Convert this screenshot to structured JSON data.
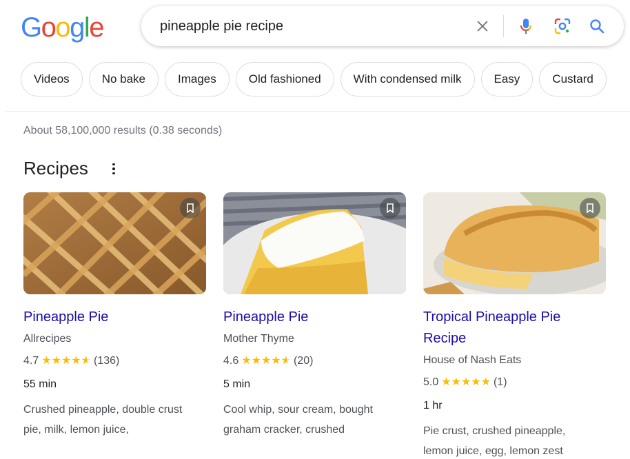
{
  "logo": {
    "letters": [
      "G",
      "o",
      "o",
      "g",
      "l",
      "e"
    ],
    "colors": [
      "#4285F4",
      "#EA4335",
      "#FBBC05",
      "#4285F4",
      "#34A853",
      "#EA4335"
    ]
  },
  "search": {
    "query": "pineapple pie recipe",
    "icons": [
      "close-icon",
      "microphone-icon",
      "lens-icon",
      "search-icon"
    ]
  },
  "chips": [
    "Videos",
    "No bake",
    "Images",
    "Old fashioned",
    "With condensed milk",
    "Easy",
    "Custard"
  ],
  "result_stats": "About 58,100,000 results (0.38 seconds)",
  "section": {
    "title": "Recipes"
  },
  "recipes": [
    {
      "title": "Pineapple Pie",
      "source": "Allrecipes",
      "rating": "4.7",
      "stars": 4.7,
      "count": "(136)",
      "time": "55 min",
      "ingredients": "Crushed pineapple, double crust pie, milk, lemon juice,"
    },
    {
      "title": "Pineapple Pie",
      "source": "Mother Thyme",
      "rating": "4.6",
      "stars": 4.6,
      "count": "(20)",
      "time": "5 min",
      "ingredients": "Cool whip, sour cream, bought graham cracker, crushed"
    },
    {
      "title": "Tropical Pineapple Pie Recipe",
      "source": "House of Nash Eats",
      "rating": "5.0",
      "stars": 5.0,
      "count": "(1)",
      "time": "1 hr",
      "ingredients": "Pie crust, crushed pineapple, lemon juice, egg, lemon zest"
    }
  ],
  "colors": {
    "link": "#1a0dab",
    "star": "#fbbc04",
    "muted": "#70757a"
  }
}
